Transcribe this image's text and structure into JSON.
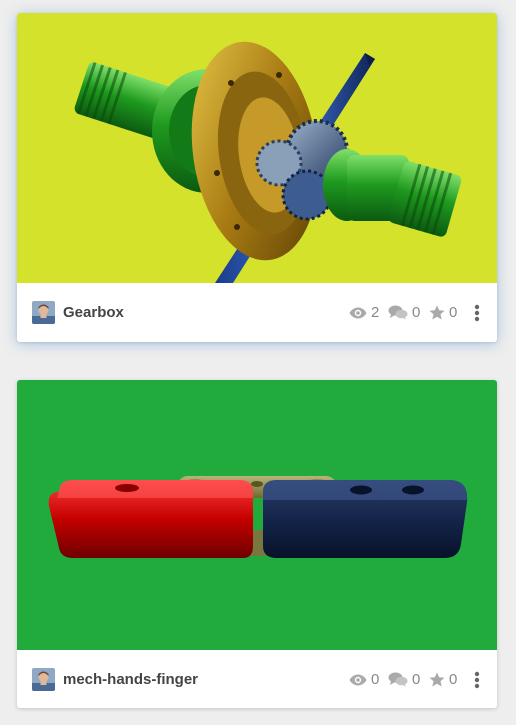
{
  "cards": [
    {
      "title": "Gearbox",
      "thumbnail_bg": "#d4e22c",
      "views": "2",
      "comments": "0",
      "likes": "0"
    },
    {
      "title": "mech-hands-finger",
      "thumbnail_bg": "#22ab3d",
      "views": "0",
      "comments": "0",
      "likes": "0"
    }
  ],
  "icons": {
    "views": "eye-icon",
    "comments": "comments-icon",
    "likes": "star-icon",
    "menu": "more-vertical-icon"
  }
}
